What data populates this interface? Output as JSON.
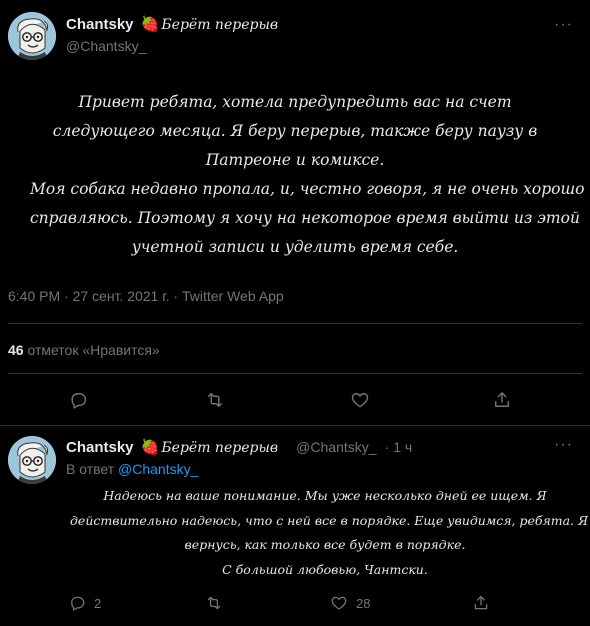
{
  "main_tweet": {
    "display_name": "Chantsky",
    "status_emoji": "🍓",
    "status_text": "Берёт перерыв",
    "handle": "@Chantsky_",
    "body_lines": [
      "Привет ребята, хотела предупредить вас на счет",
      "следующего месяца. Я беру перерыв, также беру паузу в",
      "Патреоне и комиксе.",
      "Моя собака недавно пропала, и, честно говоря, я не очень хорошо",
      "справляюсь. Поэтому я хочу на некоторое время выйти из этой",
      "учетной записи и уделить время себе."
    ],
    "timestamp": "6:40 PM · 27 сент. 2021 г. · Twitter Web App",
    "likes_count": "46",
    "likes_label": "отметок «Нравится»",
    "icons": {
      "reply": "reply-icon",
      "retweet": "retweet-icon",
      "like": "heart-icon",
      "share": "share-icon"
    }
  },
  "reply_tweet": {
    "display_name": "Chantsky",
    "status_emoji": "🍓",
    "status_text": "Берёт перерыв",
    "handle": "@Chantsky_",
    "time": "· 1 ч",
    "reply_to_prefix": "В ответ",
    "reply_to_handle": "@Chantsky_",
    "body_lines": [
      "Надеюсь на ваше понимание. Мы уже несколько дней ее ищем. Я",
      "действительно надеюсь, что с ней все в порядке. Еще увидимся, ребята. Я",
      "вернусь, как только все будет в порядке.",
      "С большой любовью, Чантски."
    ],
    "reply_count": "2",
    "retweet_count": "",
    "like_count": "28"
  },
  "colors": {
    "background": "#000000",
    "text": "#e7e9ea",
    "secondary": "#71767b",
    "link": "#1d9bf0",
    "divider": "#2f3336"
  }
}
